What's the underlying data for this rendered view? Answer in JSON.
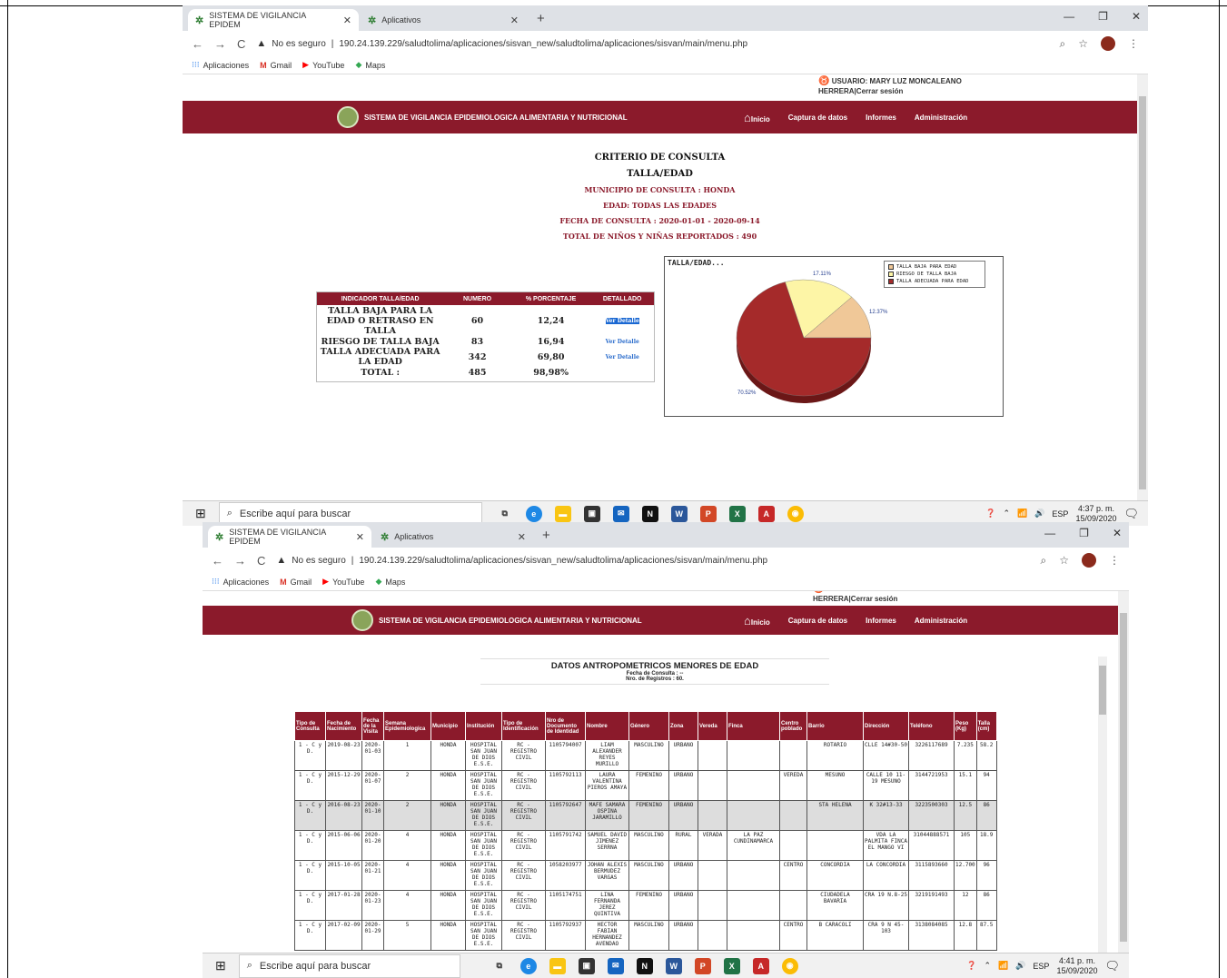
{
  "browser": {
    "tabs": [
      {
        "label": "SISTEMA DE VIGILANCIA EPIDEM"
      },
      {
        "label": "Aplicativos"
      }
    ],
    "security": "No es seguro",
    "url1": "190.24.139.229/saludtolima/aplicaciones/sisvan_new/saludtolima/aplicaciones/sisvan/main/menu.php",
    "url2": "190.24.139.229/saludtolima/aplicaciones/sisvan_new/saludtolima/aplicaciones/sisvan/main/menu.php",
    "bookmarks": [
      "Aplicaciones",
      "Gmail",
      "YouTube",
      "Maps"
    ]
  },
  "site": {
    "user_line1": "USUARIO: MARY LUZ MONCALEANO",
    "user_line2": "HERRERA|Cerrar sesión",
    "banner_title": "SISTEMA DE VIGILANCIA EPIDEMIOLOGICA ALIMENTARIA Y NUTRICIONAL",
    "menu": [
      "Inicio",
      "Captura de datos",
      "Informes",
      "Administración"
    ]
  },
  "criteria": {
    "title": "CRITERIO DE CONSULTA",
    "subtitle": "TALLA/EDAD",
    "municipio": "MUNICIPIO DE CONSULTA : HONDA",
    "edad": "EDAD: TODAS LAS EDADES",
    "fecha": "FECHA DE CONSULTA : 2020-01-01 - 2020-09-14",
    "total": "TOTAL DE NIÑOS Y NIÑAS REPORTADOS : 490"
  },
  "indicator_table": {
    "headers": [
      "INDICADOR TALLA/EDAD",
      "NUMERO",
      "% PORCENTAJE",
      "DETALLADO"
    ],
    "rows": [
      {
        "label": "TALLA BAJA PARA LA EDAD O RETRASO EN TALLA",
        "numero": "60",
        "pct": "12,24",
        "link": "Ver Detalle"
      },
      {
        "label": "RIESGO DE TALLA BAJA",
        "numero": "83",
        "pct": "16,94",
        "link": "Ver Detalle"
      },
      {
        "label": "TALLA ADECUADA PARA LA EDAD",
        "numero": "342",
        "pct": "69,80",
        "link": "Ver Detalle"
      },
      {
        "label": "TOTAL :",
        "numero": "485",
        "pct": "98,98%",
        "link": ""
      }
    ]
  },
  "chart_data": {
    "type": "pie",
    "title": "TALLA/EDAD...",
    "categories": [
      "TALLA BAJA PARA EDAD",
      "RIESGO DE TALLA BAJA",
      "TALLA ADECUADA PARA EDAD"
    ],
    "values": [
      12.37,
      17.11,
      70.52
    ],
    "labels": [
      "12.37%",
      "17.11%",
      "70.52%"
    ],
    "colors": [
      "#f0c898",
      "#fdf5a6",
      "#a52a2a"
    ],
    "legend_position": "top-right"
  },
  "report": {
    "title": "DATOS ANTROPOMETRICOS MENORES DE EDAD",
    "fecha": "Fecha de Consulta : --",
    "registros": "Nro. de Registros : 60.",
    "headers": [
      "Tipo de Consulta",
      "Fecha de Nacimiento",
      "Fecha de la Visita",
      "Semana Epidemiologica",
      "Municipio",
      "Institución",
      "Tipo de Identificación",
      "Nro de Documento de Identidad",
      "Nombre",
      "Género",
      "Zona",
      "Vereda",
      "Finca",
      "Centro poblado",
      "Barrio",
      "Dirección",
      "Teléfono",
      "Peso (Kg)",
      "Talla (cm)"
    ],
    "rows": [
      [
        "1 - C y D.",
        "2019-08-23",
        "2020-01-03",
        "1",
        "HONDA",
        "HOSPITAL SAN JUAN DE DIOS E.S.E.",
        "RC - REGISTRO CIVIL",
        "1105794007",
        "LIAM ALEXANDER REYES MURILLO",
        "MASCULINO",
        "URBANO",
        "",
        "",
        "",
        "ROTARIO",
        "CLLE 14#30-50",
        "3226117689",
        "7.235",
        "58.2"
      ],
      [
        "1 - C y D.",
        "2015-12-29",
        "2020-01-07",
        "2",
        "HONDA",
        "HOSPITAL SAN JUAN DE DIOS E.S.E.",
        "RC - REGISTRO CIVIL",
        "1105792113",
        "LAURA VALENTINA PIEROS AMAYA",
        "FEMENINO",
        "URBANO",
        "",
        "",
        "VEREDA",
        "MESUNO",
        "CALLE 10 11-19 MESUNO",
        "3144721953",
        "15.1",
        "94"
      ],
      [
        "1 - C y D.",
        "2016-08-23",
        "2020-01-10",
        "2",
        "HONDA",
        "HOSPITAL SAN JUAN DE DIOS E.S.E.",
        "RC - REGISTRO CIVIL",
        "1105792647",
        "MAFE SAMARA OSPINA JARAMILLO",
        "FEMENINO",
        "URBANO",
        "",
        "",
        "",
        "STA HELENA",
        "K 32#13-33",
        "3223500303",
        "12.5",
        "86"
      ],
      [
        "1 - C y D.",
        "2015-06-06",
        "2020-01-20",
        "4",
        "HONDA",
        "HOSPITAL SAN JUAN DE DIOS E.S.E.",
        "RC - REGISTRO CIVIL",
        "1105791742",
        "SAMUEL DAVID JIMENEZ SERRNA",
        "MASCULINO",
        "RURAL",
        "VERADA",
        "LA PAZ CUNDINAMARCA",
        "",
        "",
        "VDA LA PALMITA FINCA EL MANGO VI",
        "31044888571",
        "105",
        "18.9"
      ],
      [
        "1 - C y D.",
        "2015-10-05",
        "2020-01-21",
        "4",
        "HONDA",
        "HOSPITAL SAN JUAN DE DIOS E.S.E.",
        "RC - REGISTRO CIVIL",
        "1058203977",
        "JOHAN ALEXIS BERMUDEZ VARGAS",
        "MASCULINO",
        "URBANO",
        "",
        "",
        "CENTRO",
        "CONCORDIA",
        "LA CONCORDIA",
        "3115893660",
        "12.700",
        "96"
      ],
      [
        "1 - C y D.",
        "2017-01-28",
        "2020-01-23",
        "4",
        "HONDA",
        "HOSPITAL SAN JUAN DE DIOS E.S.E.",
        "RC - REGISTRO CIVIL",
        "1105174751",
        "LINA FERNANDA JEREZ QUINTIVA",
        "FEMENINO",
        "URBANO",
        "",
        "",
        "",
        "CIUDADELA BAVARIA",
        "CRA 19 N.8-25",
        "3219191493",
        "12",
        "86"
      ],
      [
        "1 - C y D.",
        "2017-02-09",
        "2020-01-29",
        "5",
        "HONDA",
        "HOSPITAL SAN JUAN DE DIOS E.S.E.",
        "RC - REGISTRO CIVIL",
        "1105792937",
        "HECTOR FABIAN HERNANDEZ AVENDAO",
        "MASCULINO",
        "URBANO",
        "",
        "",
        "CENTRO",
        "B CARACOLI",
        "CRA 9 N 45-103",
        "3138084085",
        "12.8",
        "87.5"
      ]
    ]
  },
  "taskbar": {
    "search_placeholder": "Escribe aquí para buscar",
    "lang": "ESP",
    "time1": "4:37 p. m.",
    "date1": "15/09/2020",
    "time2": "4:41 p. m.",
    "date2": "15/09/2020"
  }
}
